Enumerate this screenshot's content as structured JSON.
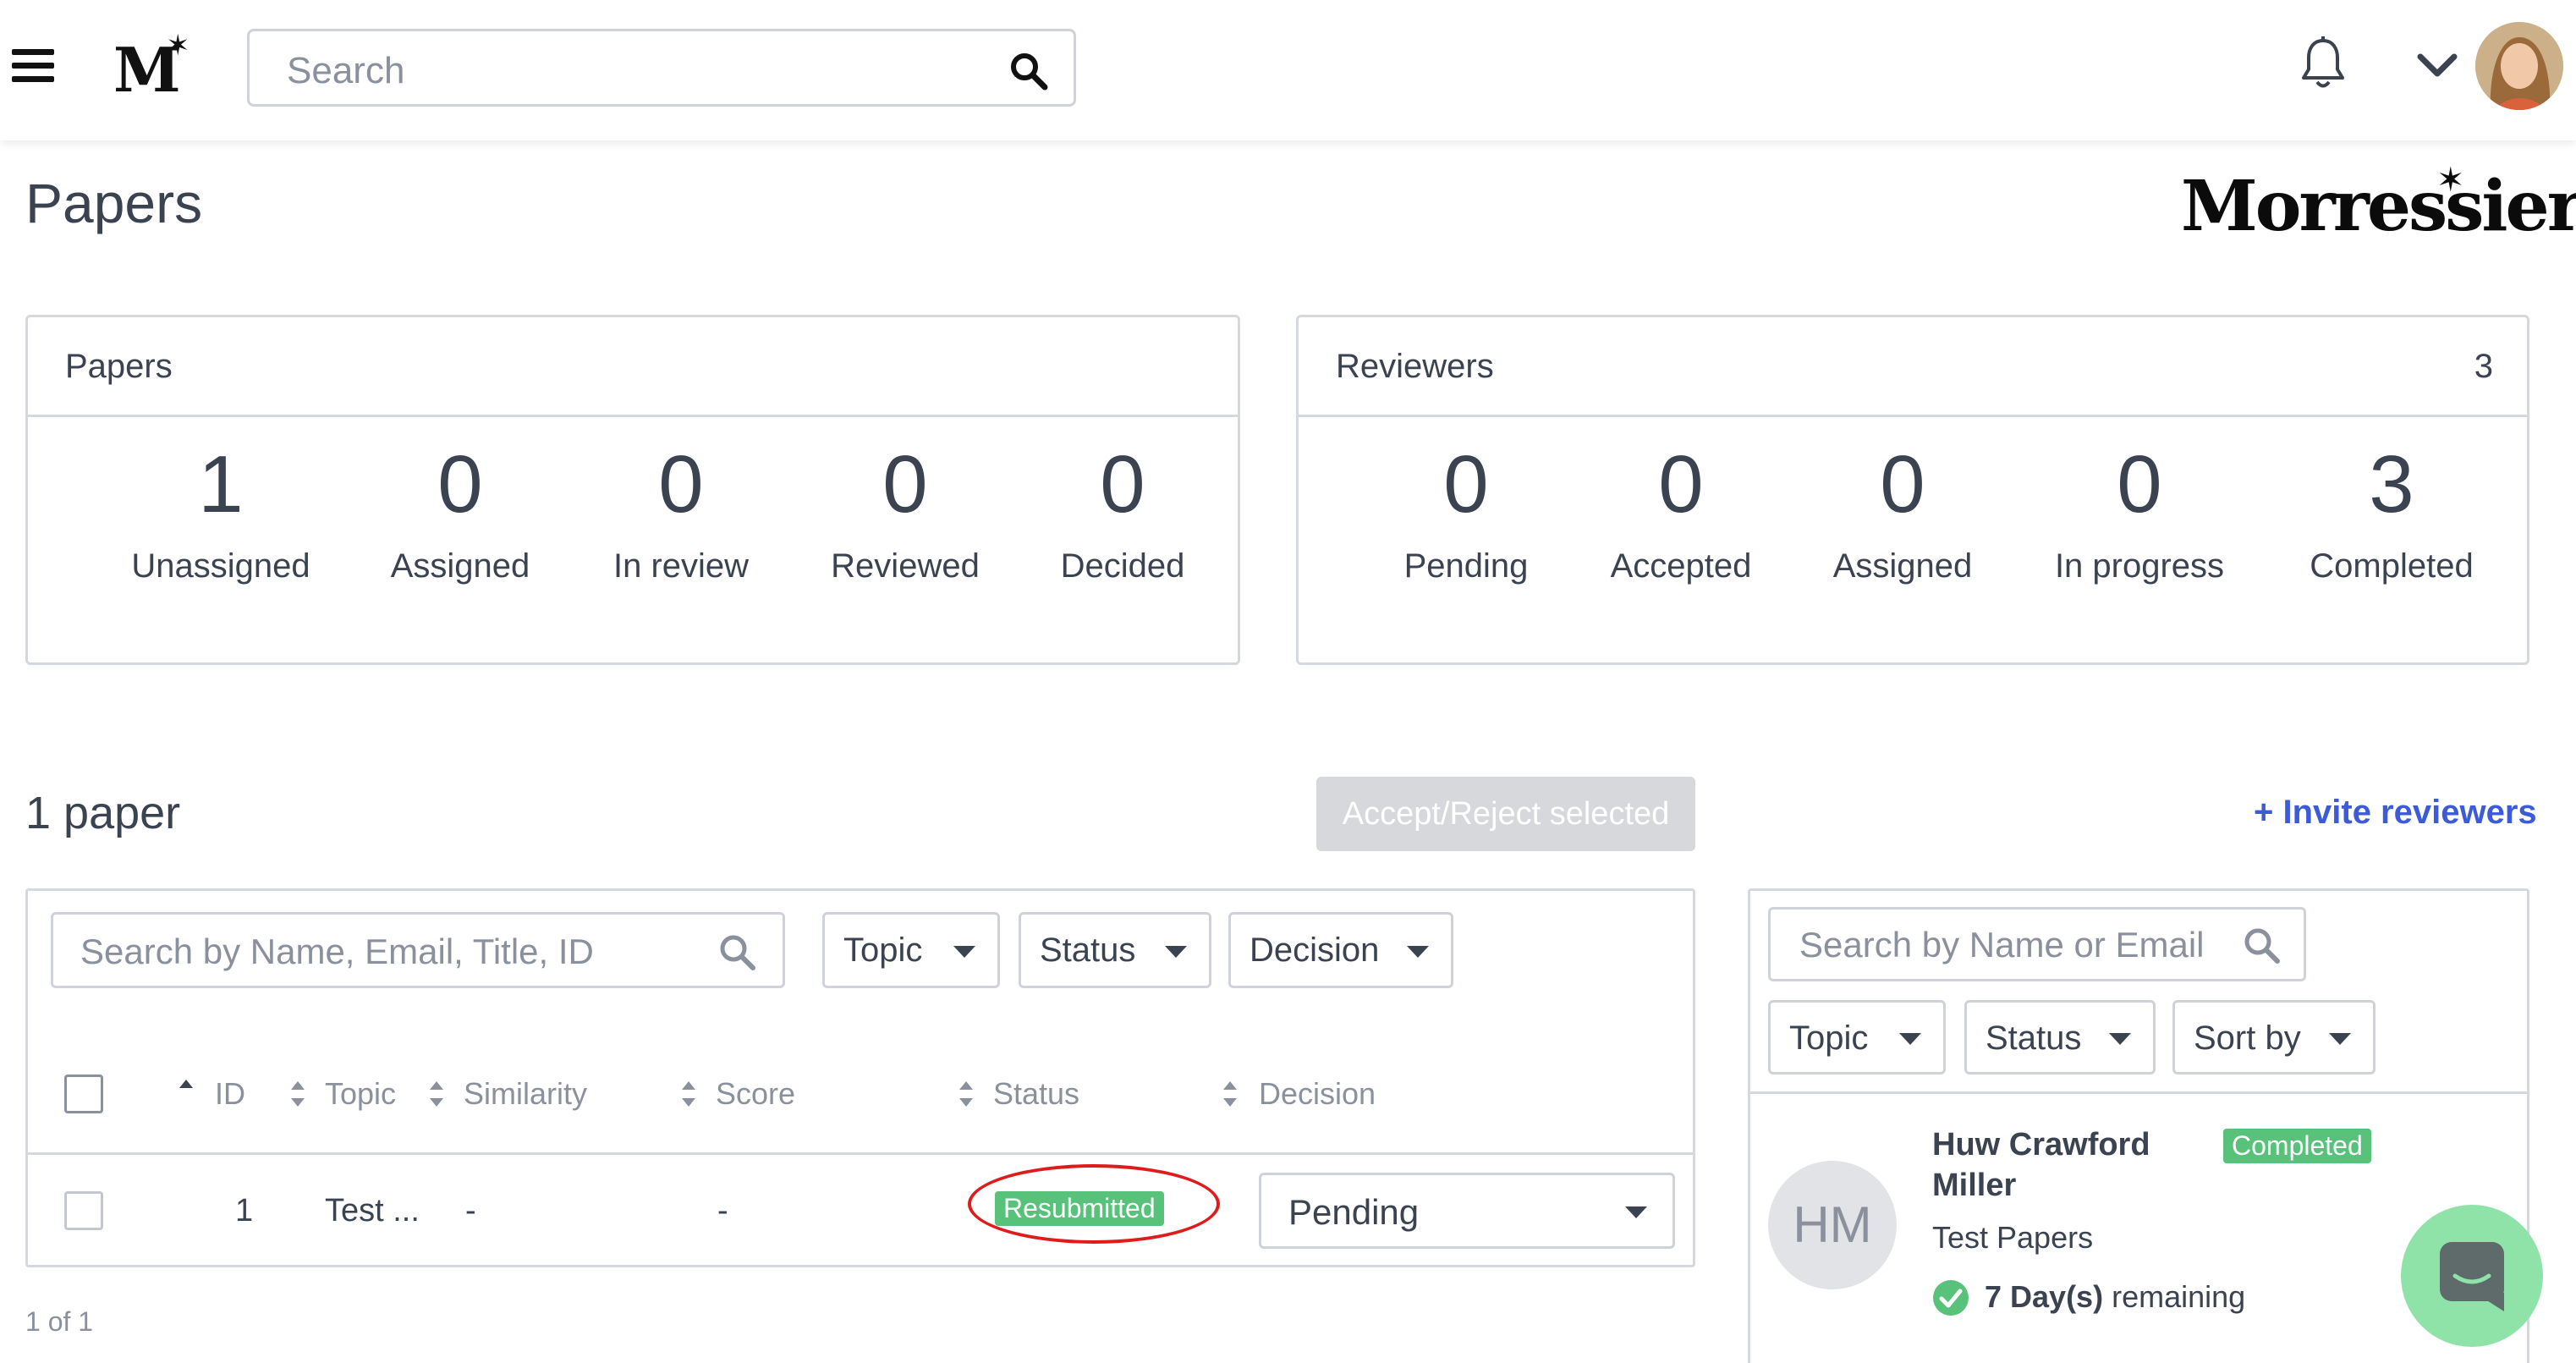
{
  "colors": {
    "accent": "#3c5bd9",
    "status_green": "#58c27a",
    "highlight": "#e01b1b",
    "chat_bg": "#8fe3a9"
  },
  "topbar": {
    "logo": "M",
    "search_placeholder": "Search",
    "icons": [
      "menu-icon",
      "search-icon",
      "bell-icon",
      "chevron-down-icon",
      "avatar"
    ]
  },
  "page": {
    "title": "Papers",
    "brand": "Morressier"
  },
  "papers_card": {
    "title": "Papers",
    "stats": [
      {
        "value": "1",
        "label": "Unassigned"
      },
      {
        "value": "0",
        "label": "Assigned"
      },
      {
        "value": "0",
        "label": "In review"
      },
      {
        "value": "0",
        "label": "Reviewed"
      },
      {
        "value": "0",
        "label": "Decided"
      }
    ]
  },
  "reviewers_card": {
    "title": "Reviewers",
    "count": "3",
    "stats": [
      {
        "value": "0",
        "label": "Pending"
      },
      {
        "value": "0",
        "label": "Accepted"
      },
      {
        "value": "0",
        "label": "Assigned"
      },
      {
        "value": "0",
        "label": "In progress"
      },
      {
        "value": "3",
        "label": "Completed"
      }
    ]
  },
  "papers_section": {
    "count_title": "1 paper",
    "bulk_action": "Accept/Reject selected",
    "invite_link": "+ Invite reviewers",
    "search_placeholder": "Search by Name, Email, Title, ID",
    "filters": [
      "Topic",
      "Status",
      "Decision"
    ],
    "columns": [
      "ID",
      "Topic",
      "Similarity",
      "Score",
      "Status",
      "Decision"
    ],
    "rows": [
      {
        "id": "1",
        "topic": "Test ...",
        "similarity": "-",
        "score": "-",
        "status": "Resubmitted",
        "decision": "Pending"
      }
    ],
    "pagination": "1 of 1"
  },
  "reviewers_panel": {
    "search_placeholder": "Search by Name or Email",
    "filters": [
      "Topic",
      "Status",
      "Sort by"
    ],
    "reviewer": {
      "initials": "HM",
      "name_line1": "Huw Crawford",
      "name_line2": "Miller",
      "status": "Completed",
      "topic": "Test Papers",
      "days_bold": "7 Day(s)",
      "days_rest": "remaining"
    }
  }
}
